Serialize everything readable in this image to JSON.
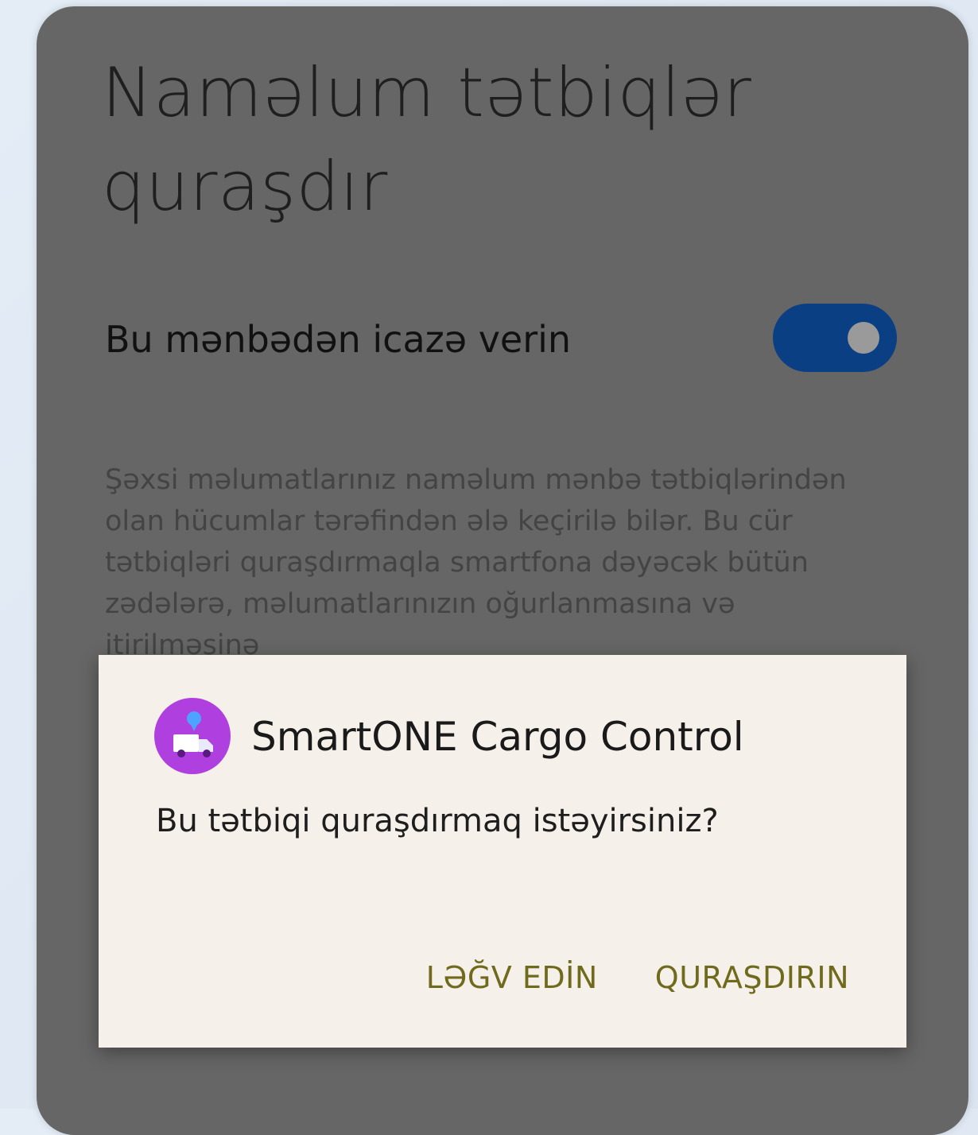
{
  "settings": {
    "title": "Naməlum tətbiqlər quraşdır",
    "toggle_label": "Bu mənbədən icazə verin",
    "toggle_on": true,
    "warning_text": "Şəxsi məlumatlarınız naməlum mənbə tətbiqlərindən olan hücumlar tərəfindən ələ keçirilə bilər. Bu cür tətbiqləri quraşdırmaqla smartfona dəyəcək bütün zədələrə, məlumatlarınızın oğurlanmasına və itirilməsinə"
  },
  "dialog": {
    "app_icon": "delivery-truck-icon",
    "app_name": "SmartONE Cargo Control",
    "question": "Bu tətbiqi quraşdırmaq istəyirsiniz?",
    "cancel_label": "LƏĞV EDİN",
    "install_label": "QURAŞDIRIN"
  },
  "colors": {
    "background_dim": "#666666",
    "toggle_track": "#0b3f83",
    "dialog_background": "#f5f0e9",
    "action_text": "#6f6a1c",
    "app_icon": "#b03fe0"
  }
}
